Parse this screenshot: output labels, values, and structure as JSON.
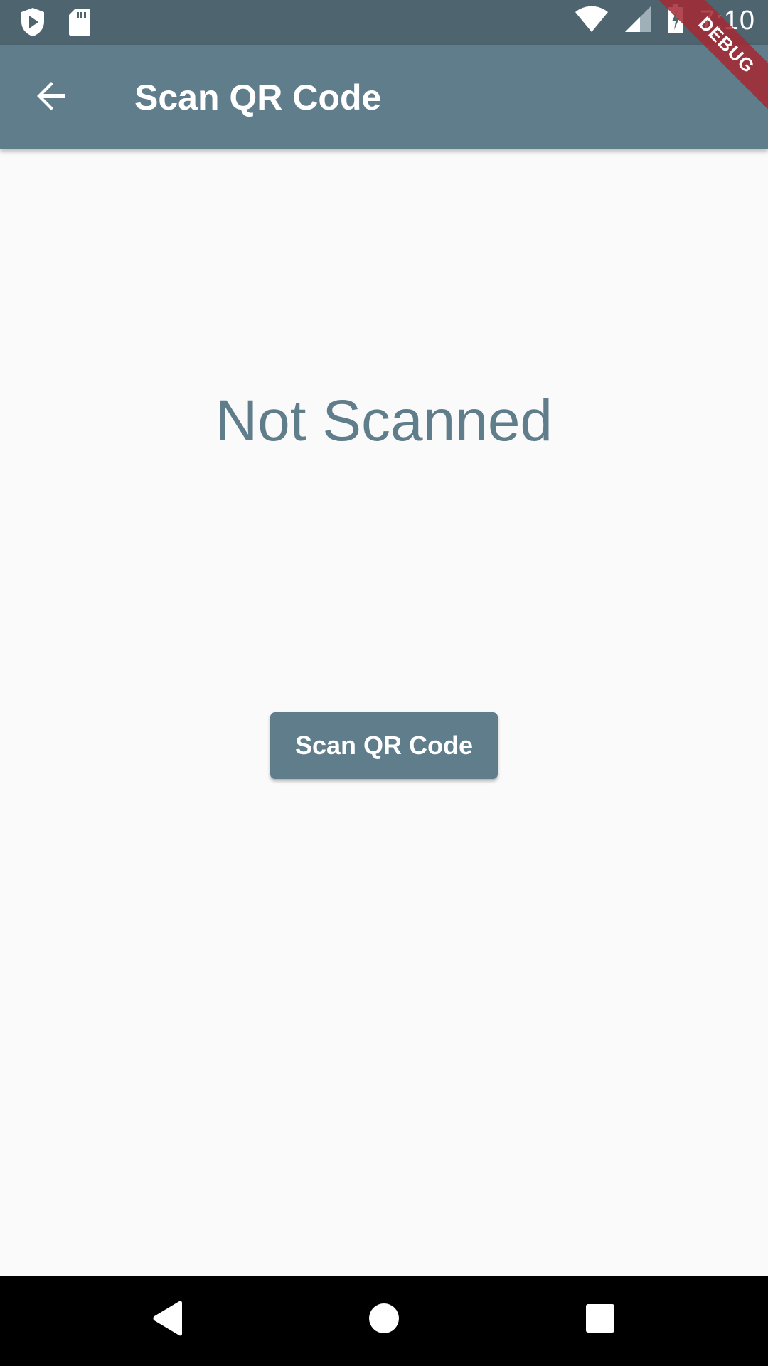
{
  "status_bar": {
    "time": "7:10",
    "icons": [
      "play-protect-icon",
      "sd-card-icon",
      "wifi-icon",
      "signal-icon",
      "battery-charging-icon"
    ]
  },
  "debug_banner": {
    "label": "DEBUG"
  },
  "app_bar": {
    "title": "Scan QR Code",
    "back_icon": "arrow-back-icon"
  },
  "main": {
    "result_text": "Not Scanned",
    "scan_button_label": "Scan QR Code"
  },
  "nav_bar": {
    "icons": [
      "back-triangle-icon",
      "home-circle-icon",
      "recents-square-icon"
    ]
  },
  "colors": {
    "status_bar": "#4e6570",
    "primary": "#607d8b",
    "background": "#fafafa",
    "debug_banner": "#a52832"
  }
}
